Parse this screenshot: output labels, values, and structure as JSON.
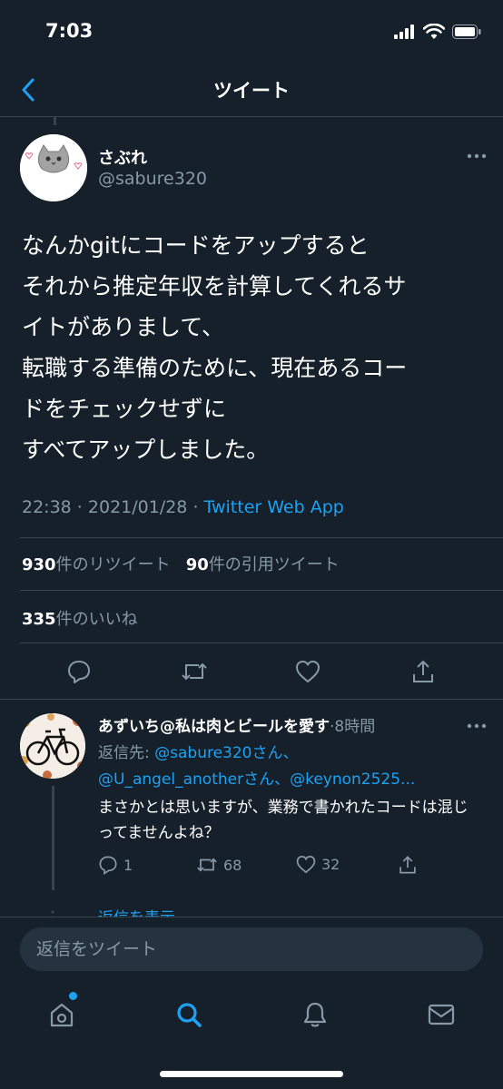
{
  "status_bar": {
    "time": "7:03"
  },
  "header": {
    "title": "ツイート"
  },
  "tweet": {
    "author_name": "さぶれ",
    "author_handle": "@sabure320",
    "text": "なんかgitにコードをアップすると\nそれから推定年収を計算してくれるサ\nイトがありまして、\n転職する準備のために、現在あるコー\nドをチェックせずに\nすべてアップしました。",
    "time": "22:38",
    "date": "2021/01/28",
    "source": "Twitter Web App",
    "retweets": "930",
    "retweets_label": "件のリツイート",
    "quotes": "90",
    "quotes_label": "件の引用ツイート",
    "likes": "335",
    "likes_label": "件のいいね"
  },
  "reply": {
    "author_name": "あずいち@私は肉とビールを愛す",
    "time_ago": "8時間",
    "reply_prefix": "返信先: ",
    "reply_to_1": "@sabure320さん、",
    "reply_to_2": "@U_angel_anotherさん、@keynon2525...",
    "text": "まさかとは思いますが、業務で書かれたコードは混じってませんよね？",
    "reply_count": "1",
    "retweet_count": "68",
    "like_count": "32",
    "show_replies": "返信を表示"
  },
  "compose": {
    "placeholder": "返信をツイート"
  },
  "colors": {
    "background": "#15202b",
    "accent": "#1da1f2",
    "muted": "#8899a6",
    "divider": "#38444d"
  },
  "icons": {
    "tabs": [
      "home-icon",
      "search-icon",
      "notifications-icon",
      "messages-icon"
    ],
    "actions": [
      "reply-icon",
      "retweet-icon",
      "like-icon",
      "share-icon"
    ]
  }
}
